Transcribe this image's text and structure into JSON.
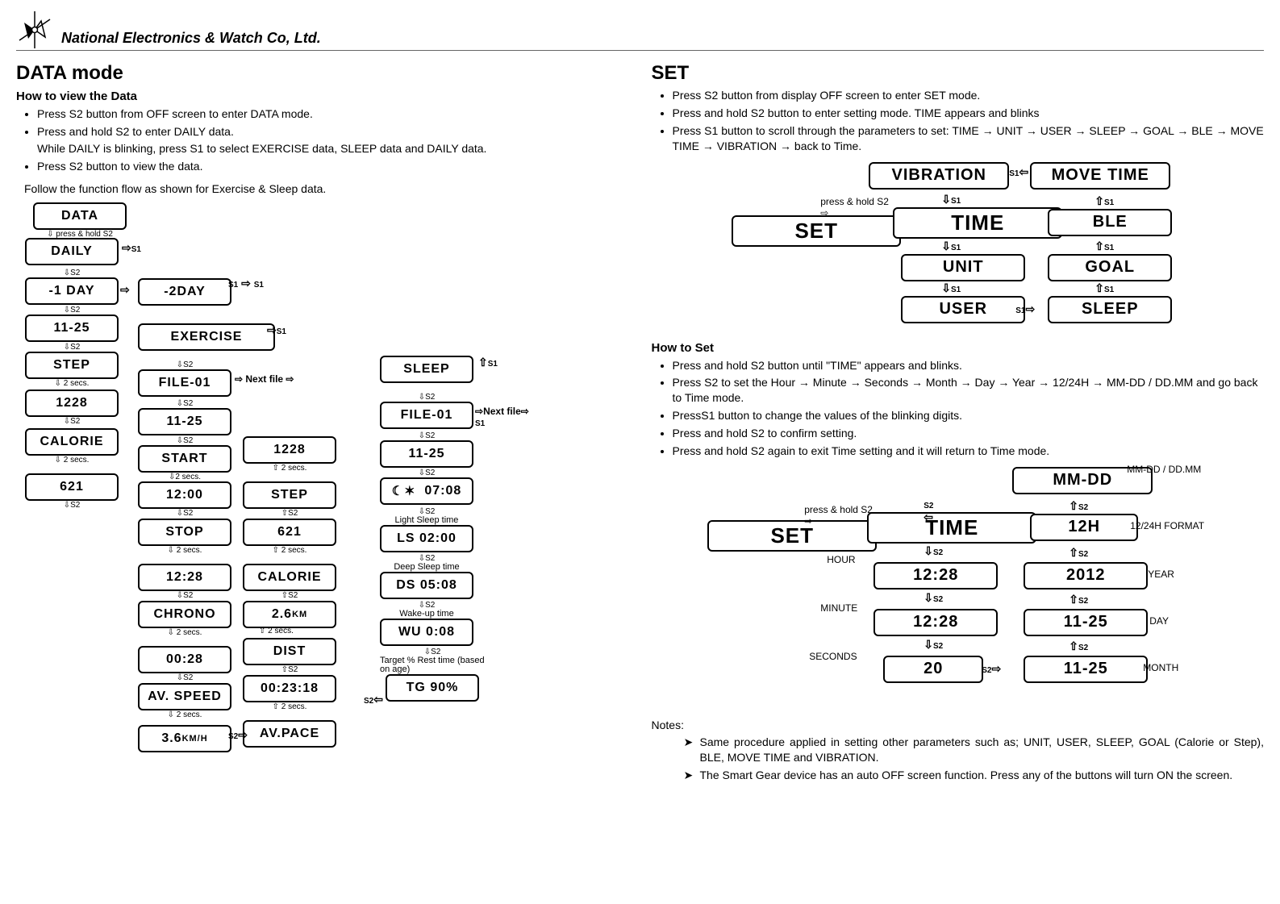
{
  "header": {
    "company": "National Electronics & Watch Co, Ltd."
  },
  "left": {
    "title": "DATA mode",
    "subtitle": "How to view the Data",
    "bullets": [
      "Press S2 button from OFF screen to enter DATA mode.",
      "Press and hold S2 to enter DAILY data.",
      "Press S2 button to view the data."
    ],
    "bullet2_sub": "While DAILY is blinking, press S1 to select EXERCISE data, SLEEP data and DAILY data.",
    "follow": "Follow the function flow as shown for Exercise & Sleep data."
  },
  "diagram1": {
    "data": "DATA",
    "press_hold_s2": "press & hold S2",
    "daily": "DAILY",
    "s1": "S1",
    "s2": "S2",
    "m1day": "-1 DAY",
    "m2day": "-2DAY",
    "date": "11-25",
    "step": "STEP",
    "secs2": "2 secs.",
    "step_val": "1228",
    "calorie": "CALORIE",
    "cal_val": "621",
    "exercise": "EXERCISE",
    "file01": "FILE-01",
    "next_file": "Next file",
    "ex_date": "11-25",
    "start": "START",
    "start_val": "12:00",
    "stop": "STOP",
    "stop_val": "12:28",
    "chrono": "CHRONO",
    "chrono_val": "00:28",
    "av_speed": "AV. SPEED",
    "av_speed_val": "3.6",
    "av_speed_unit": "KM/H",
    "av_pace": "AV.PACE",
    "dist": "DIST",
    "dist_km": "2.6",
    "dist_unit": "KM",
    "dist_time": "00:23:18",
    "step2": "STEP",
    "step2_val": "1228",
    "cal2": "CALORIE",
    "cal2_val": "621",
    "sleep": "SLEEP",
    "sleep_file": "FILE-01",
    "sleep_date": "11-25",
    "sleep_time_row": "07:08",
    "sleep_time_icon": "moon-stars-icon",
    "light_sleep_label": "Light Sleep time",
    "light_sleep": "LS  02:00",
    "deep_sleep_label": "Deep Sleep time",
    "deep_sleep": "DS  05:08",
    "wake_label": "Wake-up time",
    "wake": "WU   0:08",
    "target_label": "Target % Rest time (based on age)",
    "target": "TG    90%"
  },
  "right": {
    "title": "SET",
    "bullets_top": [
      "Press S2 button from display OFF screen to enter SET mode.",
      "Press and hold S2 button to enter setting mode. TIME appears and blinks"
    ],
    "bullet_scroll": "Press S1 button to scroll through the parameters to set: TIME → UNIT → USER → SLEEP → GOAL → BLE → MOVE TIME → VIBRATION → back to Time.",
    "how_to_set": "How to Set",
    "bullets_set": [
      "Press and hold S2 button until \"TIME\" appears and blinks.",
      "Press S2 to set the Hour → Minute → Seconds → Month → Day → Year → 12/24H → MM-DD / DD.MM and go back to Time mode.",
      "PressS1 button to change the values of the blinking digits.",
      "Press and hold S2 to confirm setting.",
      "Press and hold S2 again to exit Time setting and it will return to Time mode."
    ],
    "notes_label": "Notes:",
    "notes": [
      "Same procedure applied in setting other parameters such as; UNIT, USER, SLEEP, GOAL (Calorie or Step), BLE, MOVE TIME and VIBRATION.",
      "The Smart Gear device has an auto OFF screen function. Press any of the buttons will turn ON the screen."
    ]
  },
  "diagram2": {
    "set": "SET",
    "press_hold": "press & hold S2",
    "time": "TIME",
    "unit": "UNIT",
    "user": "USER",
    "sleep": "SLEEP",
    "goal": "GOAL",
    "ble": "BLE",
    "move_time": "MOVE TIME",
    "vibration": "VIBRATION",
    "s1": "S1"
  },
  "diagram3": {
    "set": "SET",
    "press_hold": "press & hold S2",
    "time": "TIME",
    "hour_label": "HOUR",
    "hour": "12:28",
    "minute_label": "MINUTE",
    "minute": "12:28",
    "seconds_label": "SECONDS",
    "seconds": "20",
    "month": "11-25",
    "month_label": "MONTH",
    "day": "11-25",
    "day_label": "DAY",
    "year": "2012",
    "year_label": "YEAR",
    "h12": "12H",
    "h12_label": "12/24H FORMAT",
    "mmdd": "MM-DD",
    "mmdd_label": "MM-DD / DD.MM",
    "s2": "S2"
  }
}
